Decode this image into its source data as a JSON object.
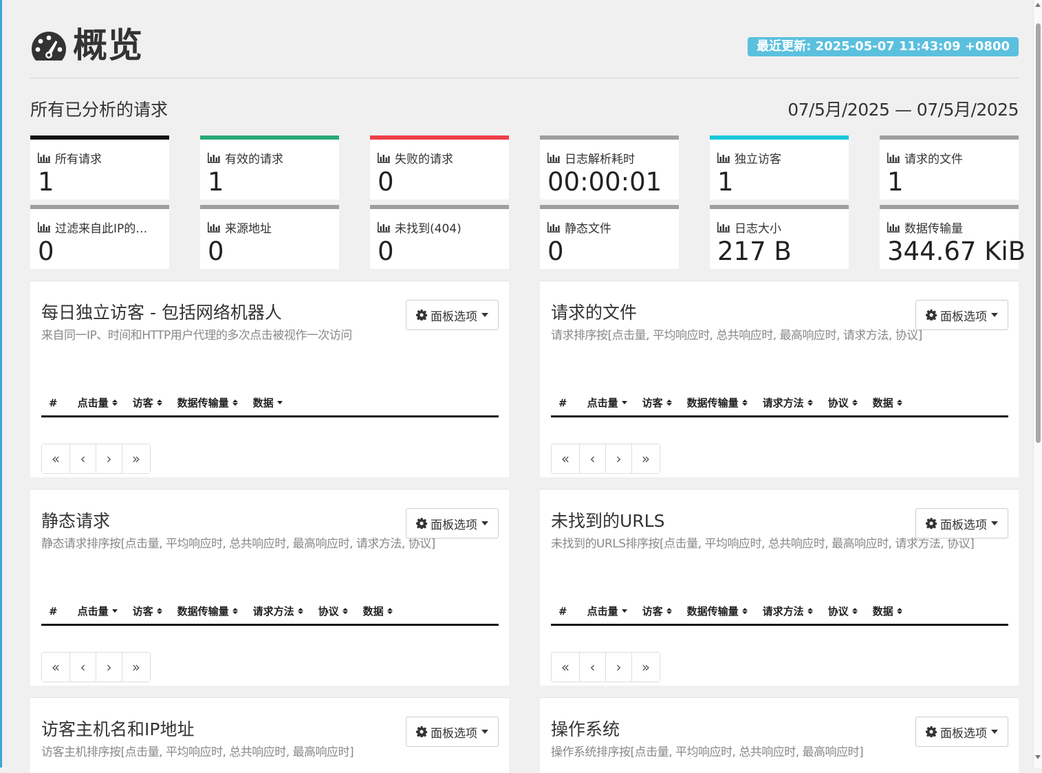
{
  "header": {
    "icon": "dashboard-icon",
    "title": "概览",
    "updated": "最近更新: 2025-05-07 11:43:09 +0800"
  },
  "subhead": {
    "title": "所有已分析的请求",
    "dates": "07/5月/2025 — 07/5月/2025"
  },
  "cards": [
    {
      "label": "所有请求",
      "value": "1",
      "color": "#111111"
    },
    {
      "label": "有效的请求",
      "value": "1",
      "color": "#2aa876"
    },
    {
      "label": "失败的请求",
      "value": "0",
      "color": "#ef3e4a"
    },
    {
      "label": "日志解析耗时",
      "value": "00:00:01",
      "color": "#9e9e9e"
    },
    {
      "label": "独立访客",
      "value": "1",
      "color": "#18c8d8"
    },
    {
      "label": "请求的文件",
      "value": "1",
      "color": "#9e9e9e"
    },
    {
      "label": "过滤来自此IP的…",
      "value": "0",
      "color": "#9e9e9e"
    },
    {
      "label": "来源地址",
      "value": "0",
      "color": "#9e9e9e"
    },
    {
      "label": "未找到(404)",
      "value": "0",
      "color": "#9e9e9e"
    },
    {
      "label": "静态文件",
      "value": "0",
      "color": "#9e9e9e"
    },
    {
      "label": "日志大小",
      "value": "217 B",
      "color": "#9e9e9e"
    },
    {
      "label": "数据传输量",
      "value": "344.67 KiB",
      "color": "#9e9e9e"
    }
  ],
  "panel_options_label": "面板选项",
  "pager": {
    "first": "«",
    "prev": "‹",
    "next": "›",
    "last": "»"
  },
  "panels": [
    {
      "title": "每日独立访客 - 包括网络机器人",
      "subtitle": "来自同一IP、时间和HTTP用户代理的多次点击被视作一次访问",
      "columns": [
        "#",
        "点击量",
        "访客",
        "数据传输量",
        "数据"
      ]
    },
    {
      "title": "请求的文件",
      "subtitle": "请求排序按[点击量, 平均响应时, 总共响应时, 最高响应时, 请求方法, 协议]",
      "columns": [
        "#",
        "点击量",
        "访客",
        "数据传输量",
        "请求方法",
        "协议",
        "数据"
      ]
    },
    {
      "title": "静态请求",
      "subtitle": "静态请求排序按[点击量, 平均响应时, 总共响应时, 最高响应时, 请求方法, 协议]",
      "columns": [
        "#",
        "点击量",
        "访客",
        "数据传输量",
        "请求方法",
        "协议",
        "数据"
      ]
    },
    {
      "title": "未找到的URLS",
      "subtitle": "未找到的URLS排序按[点击量, 平均响应时, 总共响应时, 最高响应时, 请求方法, 协议]",
      "columns": [
        "#",
        "点击量",
        "访客",
        "数据传输量",
        "请求方法",
        "协议",
        "数据"
      ]
    },
    {
      "title": "访客主机名和IP地址",
      "subtitle": "访客主机排序按[点击量, 平均响应时, 总共响应时, 最高响应时]",
      "columns": []
    },
    {
      "title": "操作系统",
      "subtitle": "操作系统排序按[点击量, 平均响应时, 总共响应时, 最高响应时]",
      "columns": []
    }
  ]
}
